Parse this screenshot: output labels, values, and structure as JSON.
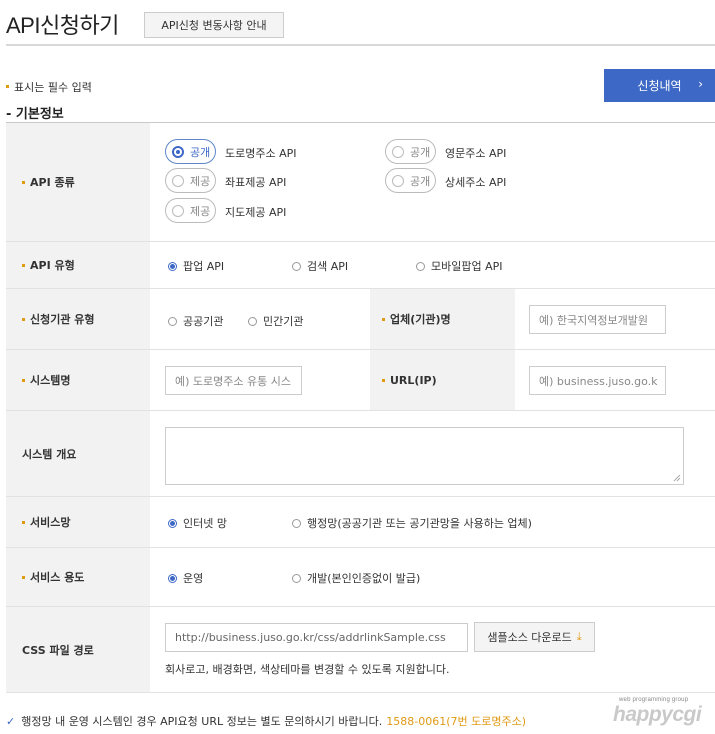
{
  "header": {
    "title": "API신청하기",
    "notice_button": "API신청 변동사항 안내"
  },
  "required_note": "표시는 필수 입력",
  "apply_button": "신청내역",
  "section_title": "기본정보",
  "rows": {
    "api_kind": {
      "label": "API 종류",
      "options": [
        {
          "tag": "공개",
          "label": "도로명주소 API",
          "selected": true
        },
        {
          "tag": "공개",
          "label": "영문주소 API",
          "selected": false
        },
        {
          "tag": "제공",
          "label": "좌표제공 API",
          "selected": false
        },
        {
          "tag": "공개",
          "label": "상세주소 API",
          "selected": false
        },
        {
          "tag": "제공",
          "label": "지도제공 API",
          "selected": false
        }
      ]
    },
    "api_type": {
      "label": "API 유형",
      "options": [
        "팝업 API",
        "검색 API",
        "모바일팝업 API"
      ],
      "selected": "팝업 API"
    },
    "org_type": {
      "label": "신청기관 유형",
      "options": [
        "공공기관",
        "민간기관"
      ],
      "selected": null,
      "company_label": "업체(기관)명",
      "company_placeholder": "예) 한국지역정보개발원"
    },
    "system": {
      "label": "시스템명",
      "placeholder": "예) 도로명주소 유통 시스",
      "url_label": "URL(IP)",
      "url_placeholder": "예) business.juso.go.k"
    },
    "overview": {
      "label": "시스템 개요"
    },
    "service_network": {
      "label": "서비스망",
      "options": [
        "인터넷 망",
        "행정망(공공기관 또는 공기관망을 사용하는 업체)"
      ],
      "selected": "인터넷 망"
    },
    "service_use": {
      "label": "서비스 용도",
      "options": [
        "운영",
        "개발(본인인증없이 발급)"
      ],
      "selected": "운영"
    },
    "css_path": {
      "label": "CSS 파일 경로",
      "value": "http://business.juso.go.kr/css/addrlinkSample.css",
      "download_button": "샘플소스 다운로드",
      "helper": "회사로고, 배경화면, 색상테마를 변경할 수 있도록 지원합니다."
    }
  },
  "footer": {
    "text": "행정망 내 운영 시스템인 경우 API요청 URL 정보는 별도 문의하시기 바랍니다.",
    "phone": "1588-0061(7번 도로명주소)"
  },
  "logo": {
    "small": "web programming group",
    "big": "happycgi"
  },
  "colors": {
    "accent": "#3e68c6",
    "required_dot": "#e09a14",
    "header_bg": "#f2f2f2"
  }
}
